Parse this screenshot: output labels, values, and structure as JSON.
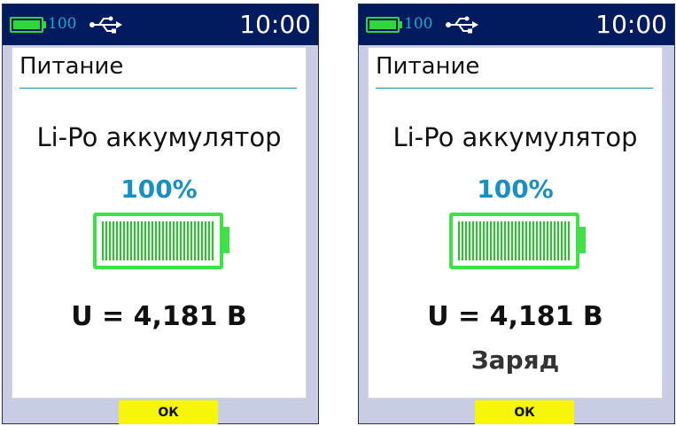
{
  "screens": [
    {
      "status": {
        "battery_level": "100",
        "time": "10:00",
        "battery_icon": "battery-icon",
        "usb_icon": "usb-icon"
      },
      "title": "Питание",
      "battery_type": "Li-Po аккумулятор",
      "charge_percent": "100%",
      "charge_fraction": 1.0,
      "voltage": "U = 4,181 В",
      "charge_state": "",
      "ok_label": "ОК"
    },
    {
      "status": {
        "battery_level": "100",
        "time": "10:00",
        "battery_icon": "battery-icon",
        "usb_icon": "usb-icon"
      },
      "title": "Питание",
      "battery_type": "Li-Po аккумулятор",
      "charge_percent": "100%",
      "charge_fraction": 1.0,
      "voltage": "U = 4,181 В",
      "charge_state": "Заряд",
      "ok_label": "ОК"
    }
  ],
  "colors": {
    "status_bar": "#011b5e",
    "battery_green": "#3fe148",
    "percent_blue": "#1b8fc0",
    "ok_yellow": "#f6f50a",
    "frame_background": "#c9cde3"
  }
}
